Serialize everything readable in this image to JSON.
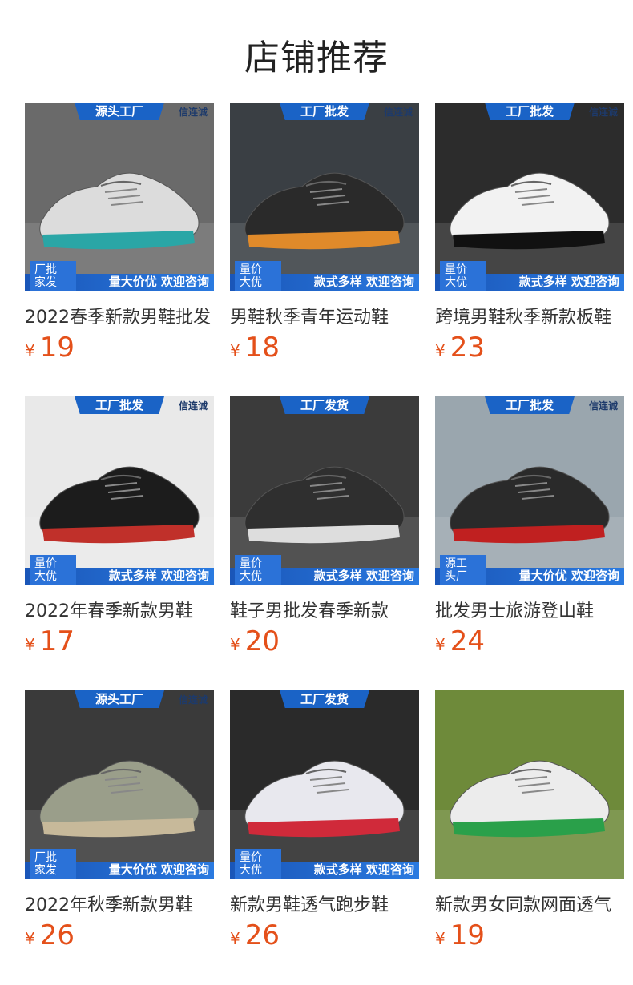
{
  "page_title": "店铺推荐",
  "products": [
    {
      "name": "2022春季新款男鞋批发",
      "currency": "¥",
      "price": "19",
      "ribbon": "源头工厂",
      "brand": "信连诚",
      "corner": "厂批 家发",
      "band": "量大价优 欢迎咨询",
      "shoe_color": "#dcdcdc",
      "accent": "#2aa6a6",
      "bg": "#6a6a6a"
    },
    {
      "name": "男鞋秋季青年运动鞋",
      "currency": "¥",
      "price": "18",
      "ribbon": "工厂批发",
      "brand": "信连诚",
      "corner": "量价 大优",
      "band": "款式多样 欢迎咨询",
      "shoe_color": "#2a2a2a",
      "accent": "#e08a2a",
      "bg": "#3a3f44"
    },
    {
      "name": "跨境男鞋秋季新款板鞋",
      "currency": "¥",
      "price": "23",
      "ribbon": "工厂批发",
      "brand": "信连诚",
      "corner": "量价 大优",
      "band": "款式多样 欢迎咨询",
      "shoe_color": "#f2f2f2",
      "accent": "#111111",
      "bg": "#2c2c2c"
    },
    {
      "name": "2022年春季新款男鞋",
      "currency": "¥",
      "price": "17",
      "ribbon": "工厂批发",
      "brand": "信连诚",
      "corner": "量价 大优",
      "band": "款式多样 欢迎咨询",
      "shoe_color": "#1c1c1c",
      "accent": "#c0302a",
      "bg": "#e9e9e9"
    },
    {
      "name": "鞋子男批发春季新款",
      "currency": "¥",
      "price": "20",
      "ribbon": "工厂发货",
      "brand": "",
      "corner": "量价 大优",
      "band": "款式多样 欢迎咨询",
      "shoe_color": "#2f2f2f",
      "accent": "#dddddd",
      "bg": "#3b3b3b"
    },
    {
      "name": "批发男士旅游登山鞋",
      "currency": "¥",
      "price": "24",
      "ribbon": "工厂批发",
      "brand": "信连诚",
      "corner": "源工 头厂",
      "band": "量大价优 欢迎咨询",
      "shoe_color": "#2a2a2a",
      "accent": "#c02020",
      "bg": "#9aa6ae"
    },
    {
      "name": "2022年秋季新款男鞋",
      "currency": "¥",
      "price": "26",
      "ribbon": "源头工厂",
      "brand": "信连诚",
      "corner": "厂批 家发",
      "band": "量大价优 欢迎咨询",
      "shoe_color": "#9a9e8a",
      "accent": "#c7b99a",
      "bg": "#3a3a3a"
    },
    {
      "name": "新款男鞋透气跑步鞋",
      "currency": "¥",
      "price": "26",
      "ribbon": "工厂发货",
      "brand": "",
      "corner": "量价 大优",
      "band": "款式多样 欢迎咨询",
      "shoe_color": "#e8e8ee",
      "accent": "#d02a3a",
      "bg": "#2a2a2a"
    },
    {
      "name": "新款男女同款网面透气",
      "currency": "¥",
      "price": "19",
      "ribbon": "",
      "brand": "",
      "corner": "",
      "band": "",
      "shoe_color": "#ececec",
      "accent": "#2aa04a",
      "bg": "#6e8a3a"
    }
  ]
}
